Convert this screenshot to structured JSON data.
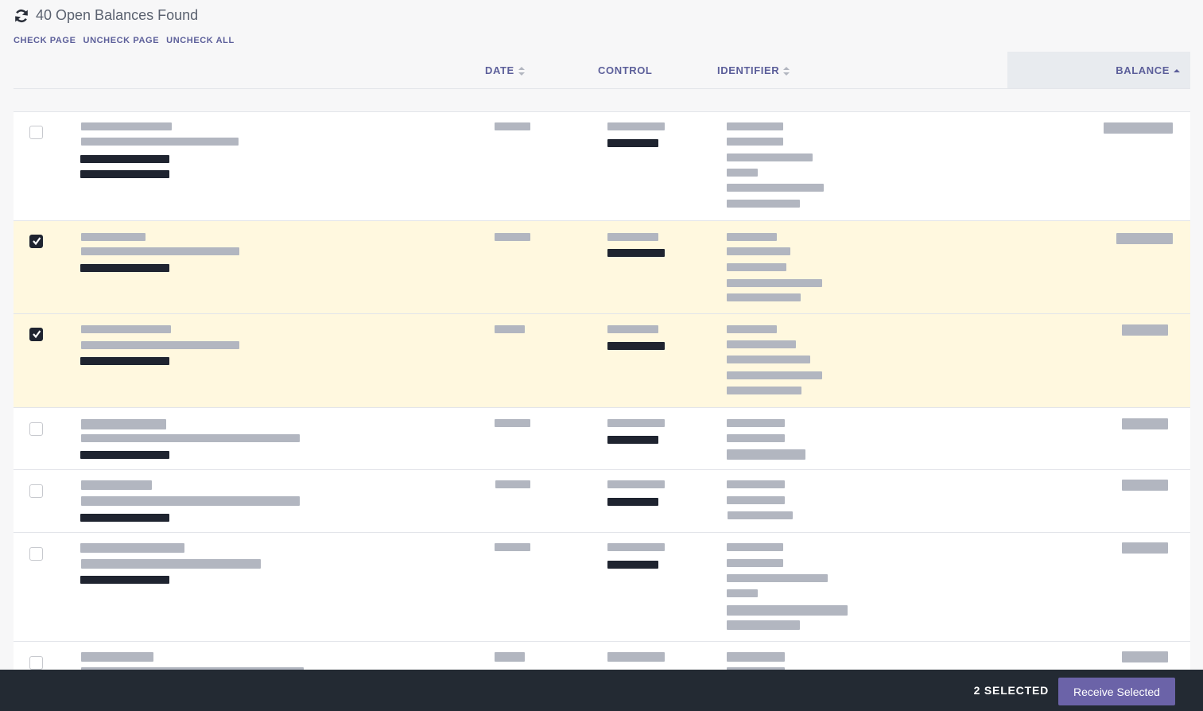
{
  "header": {
    "title": "40 Open Balances Found",
    "refresh_icon": "refresh-icon"
  },
  "actions": {
    "check_page": "CHECK PAGE",
    "uncheck_page": "UNCHECK PAGE",
    "uncheck_all": "UNCHECK ALL"
  },
  "columns": {
    "date": "DATE",
    "control": "CONTROL",
    "identifier": "IDENTIFIER",
    "balance": "BALANCE"
  },
  "sort_icons": {
    "date": "sort-both-icon",
    "identifier": "sort-both-icon",
    "balance": "sort-ascending-icon"
  },
  "rows_checked": [
    false,
    true,
    true,
    false,
    false,
    false,
    false
  ],
  "footer": {
    "selected_count": "2 SELECTED",
    "receive_label": "Receive Selected"
  },
  "colors": {
    "accent": "#5c5f9a",
    "button": "#6b63a8",
    "selected_row": "#fff8df",
    "footer_bg": "#232a33"
  }
}
